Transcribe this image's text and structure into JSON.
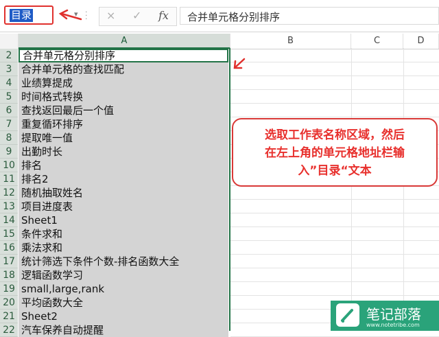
{
  "formula_bar": {
    "name_box_value": "目录",
    "name_box_dropdown": "▾",
    "cancel_label": "×",
    "accept_label": "✓",
    "fx_label": "fx",
    "formula_content": "合并单元格分别排序"
  },
  "columns": [
    "A",
    "B",
    "C",
    "D"
  ],
  "rows": [
    {
      "num": "2",
      "a": "合并单元格分别排序"
    },
    {
      "num": "3",
      "a": "合并单元格的查找匹配"
    },
    {
      "num": "4",
      "a": "业绩算提成"
    },
    {
      "num": "5",
      "a": "时间格式转换"
    },
    {
      "num": "6",
      "a": "查找返回最后一个值"
    },
    {
      "num": "7",
      "a": "重复循环排序"
    },
    {
      "num": "8",
      "a": "提取唯一值"
    },
    {
      "num": "9",
      "a": "出勤时长"
    },
    {
      "num": "10",
      "a": "排名"
    },
    {
      "num": "11",
      "a": "排名2"
    },
    {
      "num": "12",
      "a": "随机抽取姓名"
    },
    {
      "num": "13",
      "a": "项目进度表"
    },
    {
      "num": "14",
      "a": "Sheet1"
    },
    {
      "num": "15",
      "a": "条件求和"
    },
    {
      "num": "16",
      "a": "乘法求和"
    },
    {
      "num": "17",
      "a": "统计筛选下条件个数-排名函数大全"
    },
    {
      "num": "18",
      "a": "逻辑函数学习"
    },
    {
      "num": "19",
      "a": "small,large,rank"
    },
    {
      "num": "20",
      "a": "平均函数大全"
    },
    {
      "num": "21",
      "a": "Sheet2"
    },
    {
      "num": "22",
      "a": "汽车保养自动提醒"
    }
  ],
  "callout": {
    "line1": "选取工作表名称区域，然后",
    "line2": "在左上角的单元格地址栏输",
    "line3": "入”目录“文本"
  },
  "watermark": {
    "name": "笔记部落",
    "url": "www.notetribe.com",
    "icon": "pen-icon"
  },
  "colors": {
    "selection_green": "#217346",
    "annotation_red": "#e0302d",
    "name_box_highlight": "#1e5bc6",
    "logo_green": "#2aa37a"
  }
}
